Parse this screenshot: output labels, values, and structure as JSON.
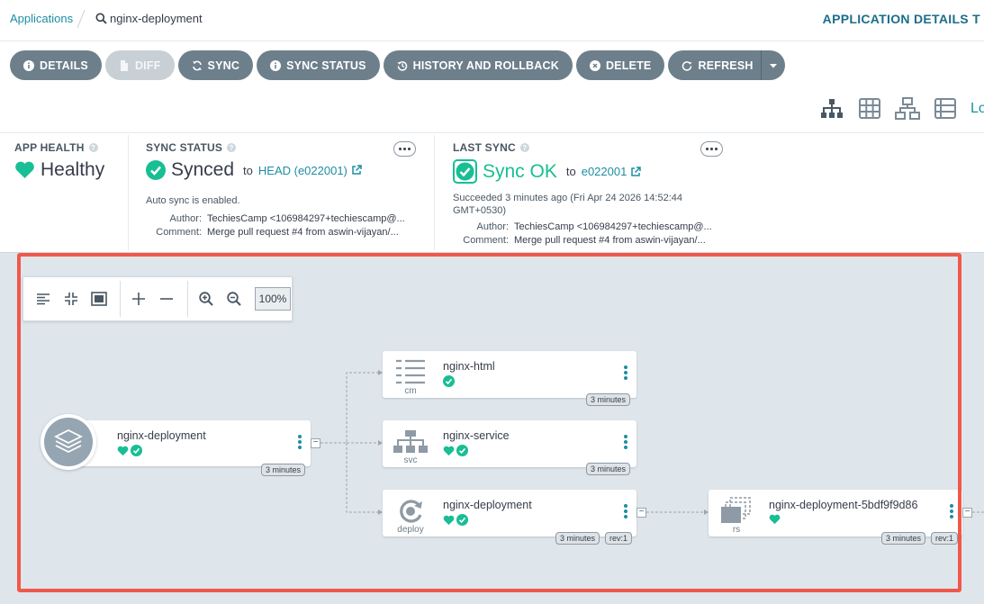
{
  "breadcrumb": {
    "root": "Applications",
    "current": "nginx-deployment"
  },
  "header": {
    "right_title": "APPLICATION DETAILS T"
  },
  "actions": [
    {
      "label": "DETAILS",
      "icon": "info-icon",
      "enabled": true
    },
    {
      "label": "DIFF",
      "icon": "file-icon",
      "enabled": false
    },
    {
      "label": "SYNC",
      "icon": "sync-icon",
      "enabled": true
    },
    {
      "label": "SYNC STATUS",
      "icon": "info-icon",
      "enabled": true
    },
    {
      "label": "HISTORY AND ROLLBACK",
      "icon": "history-icon",
      "enabled": true
    },
    {
      "label": "DELETE",
      "icon": "times-circle-icon",
      "enabled": true
    },
    {
      "label": "REFRESH",
      "icon": "redo-icon",
      "enabled": true
    }
  ],
  "view_icons": [
    "tree-view-icon",
    "grid-view-icon",
    "network-view-icon",
    "list-view-icon"
  ],
  "view_log_label": "Lo",
  "app_health": {
    "title": "APP HEALTH",
    "value": "Healthy",
    "color": "#18be94"
  },
  "sync_status": {
    "title": "SYNC STATUS",
    "value": "Synced",
    "to": "to",
    "revision": "HEAD (e022001)",
    "note": "Auto sync is enabled.",
    "author_label": "Author:",
    "author": "TechiesCamp <106984297+techiescamp@...",
    "comment_label": "Comment:",
    "comment": "Merge pull request #4 from aswin-vijayan/..."
  },
  "last_sync": {
    "title": "LAST SYNC",
    "value": "Sync OK",
    "to": "to",
    "revision": "e022001",
    "succeeded_line1": "Succeeded 3 minutes ago (Fri Apr 24 2026 14:52:44",
    "succeeded_line2": "GMT+0530)",
    "author_label": "Author:",
    "author": "TechiesCamp <106984297+techiescamp@...",
    "comment_label": "Comment:",
    "comment": "Merge pull request #4 from aswin-vijayan/..."
  },
  "zoom": {
    "level": "100%"
  },
  "graph": {
    "app_node": {
      "name": "nginx-deployment",
      "age": "3 minutes"
    },
    "cm_node": {
      "name": "nginx-html",
      "kind": "cm",
      "age": "3 minutes"
    },
    "svc_node": {
      "name": "nginx-service",
      "kind": "svc",
      "age": "3 minutes"
    },
    "deploy_node": {
      "name": "nginx-deployment",
      "kind": "deploy",
      "age": "3 minutes",
      "rev": "rev:1"
    },
    "rs_node": {
      "name": "nginx-deployment-5bdf9f9d86",
      "kind": "rs",
      "age": "3 minutes",
      "rev": "rev:1"
    }
  },
  "colors": {
    "healthy": "#18be94",
    "synced": "#18be94",
    "link": "#1e8da4",
    "button": "#6d7f8b",
    "highlight": "#f0584b"
  }
}
